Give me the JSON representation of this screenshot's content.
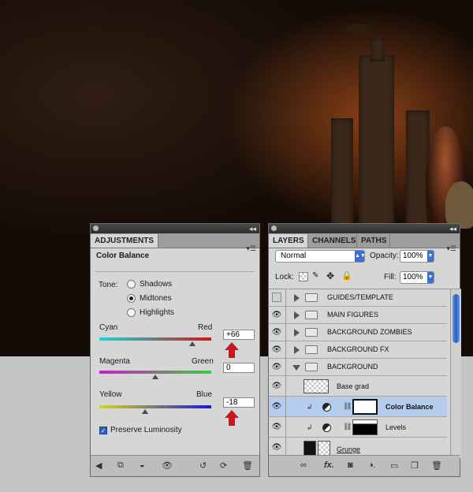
{
  "adjustments": {
    "tab_label": "ADJUSTMENTS",
    "title": "Color Balance",
    "tone_label": "Tone:",
    "tones": [
      {
        "label": "Shadows",
        "selected": false
      },
      {
        "label": "Midtones",
        "selected": true
      },
      {
        "label": "Highlights",
        "selected": false
      }
    ],
    "sliders": [
      {
        "left": "Cyan",
        "right": "Red",
        "value": "+66",
        "fraction": 0.83
      },
      {
        "left": "Magenta",
        "right": "Green",
        "value": "0",
        "fraction": 0.5
      },
      {
        "left": "Yellow",
        "right": "Blue",
        "value": "-18",
        "fraction": 0.41
      }
    ],
    "preserve_label": "Preserve Luminosity",
    "preserve_checked": true
  },
  "layers": {
    "tabs": [
      "LAYERS",
      "CHANNELS",
      "PATHS"
    ],
    "blend_mode": "Normal",
    "opacity_label": "Opacity:",
    "opacity_value": "100%",
    "lock_label": "Lock:",
    "fill_label": "Fill:",
    "fill_value": "100%",
    "rows": [
      {
        "name": "GUIDES/TEMPLATE",
        "visible": false
      },
      {
        "name": "MAIN FIGURES",
        "visible": true
      },
      {
        "name": "BACKGROUND ZOMBIES",
        "visible": true
      },
      {
        "name": "BACKGROUND FX",
        "visible": true
      },
      {
        "name": "BACKGROUND",
        "visible": true
      },
      {
        "name": "Base grad",
        "visible": true
      },
      {
        "name": "Color Balance",
        "visible": true,
        "selected": true
      },
      {
        "name": "Levels",
        "visible": true
      },
      {
        "name": "Grunge",
        "visible": true
      }
    ]
  },
  "colors": {
    "accent": "#3b6fd6",
    "selection": "#b4cdee",
    "arrow": "#c8171e"
  }
}
